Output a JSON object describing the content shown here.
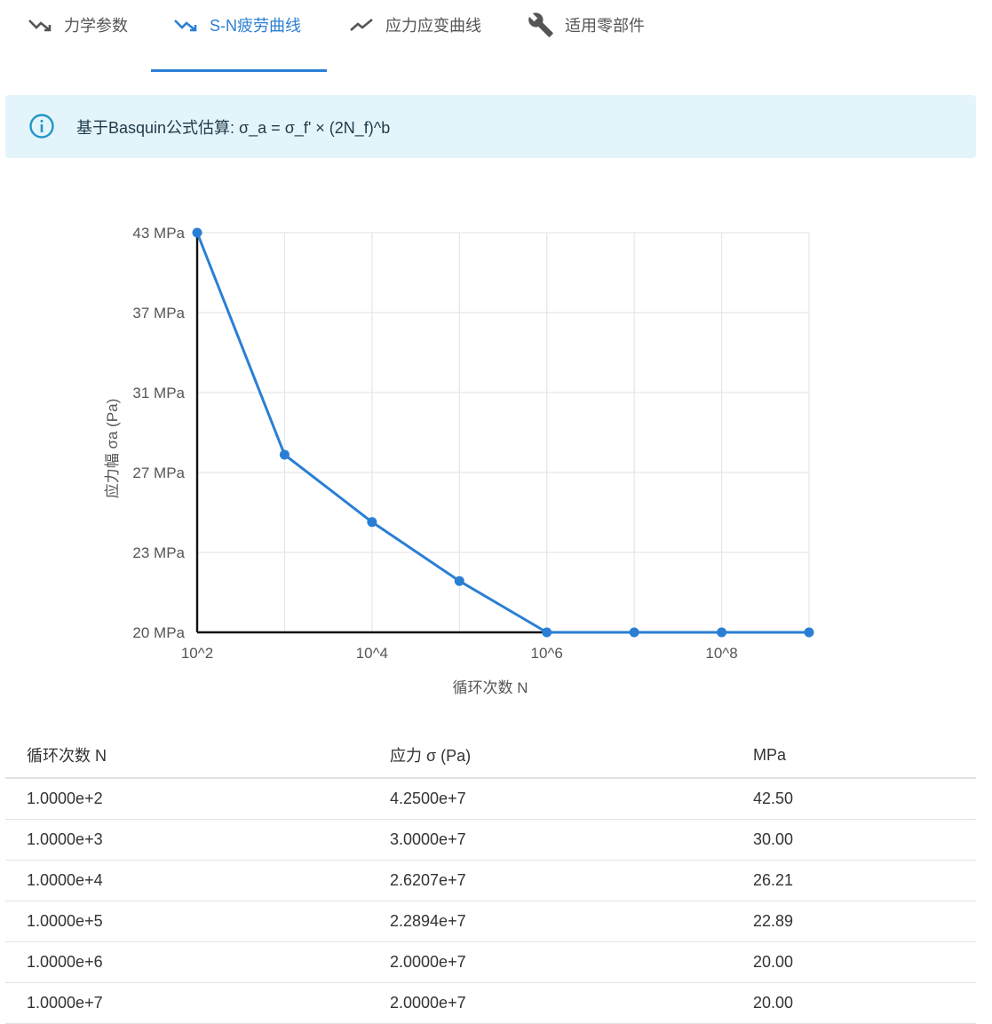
{
  "tabs": [
    {
      "label": "力学参数",
      "icon": "trending-down-icon",
      "active": false
    },
    {
      "label": "S-N疲劳曲线",
      "icon": "trending-down-icon",
      "active": true
    },
    {
      "label": "应力应变曲线",
      "icon": "trending-up-icon",
      "active": false
    },
    {
      "label": "适用零部件",
      "icon": "wrench-icon",
      "active": false
    }
  ],
  "colors": {
    "accent": "#2a7fd4",
    "info_bg": "#e4f4fb",
    "info_icon": "#2196c9"
  },
  "info": {
    "icon": "info-icon",
    "text": "基于Basquin公式估算: σ_a = σ_f' × (2N_f)^b"
  },
  "chart_data": {
    "type": "line",
    "x": [
      100,
      1000,
      10000,
      100000,
      1000000,
      10000000,
      100000000,
      1000000000
    ],
    "y": [
      42.5,
      30.0,
      26.21,
      22.89,
      20.0,
      20.0,
      20.0,
      20.0
    ],
    "xscale": "log",
    "xlim": [
      100,
      1000000000
    ],
    "ylim": [
      20,
      42.5
    ],
    "xticks": [
      "10^2",
      "10^4",
      "10^6",
      "10^8"
    ],
    "yticks": [
      "20 MPa",
      "23 MPa",
      "27 MPa",
      "31 MPa",
      "37 MPa",
      "43 MPa"
    ],
    "xlabel": "循环次数 N",
    "ylabel": "应力幅 σa (Pa)",
    "grid": true,
    "color": "#2a7fd4"
  },
  "table": {
    "headers": [
      "循环次数 N",
      "应力 σ (Pa)",
      "MPa"
    ],
    "rows": [
      [
        "1.0000e+2",
        "4.2500e+7",
        "42.50"
      ],
      [
        "1.0000e+3",
        "3.0000e+7",
        "30.00"
      ],
      [
        "1.0000e+4",
        "2.6207e+7",
        "26.21"
      ],
      [
        "1.0000e+5",
        "2.2894e+7",
        "22.89"
      ],
      [
        "1.0000e+6",
        "2.0000e+7",
        "20.00"
      ],
      [
        "1.0000e+7",
        "2.0000e+7",
        "20.00"
      ]
    ]
  }
}
